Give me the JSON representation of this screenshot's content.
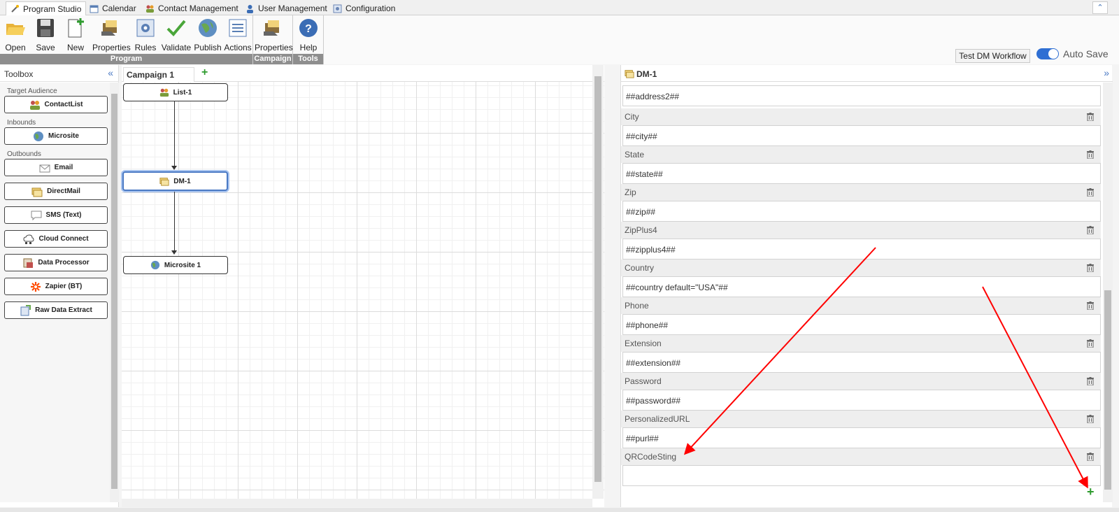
{
  "top_tabs": [
    "Program Studio",
    "Calendar",
    "Contact Management",
    "User Management",
    "Configuration"
  ],
  "ribbon": {
    "program_group": {
      "label": "Program",
      "buttons": [
        "Open",
        "Save",
        "New",
        "Properties",
        "Rules",
        "Validate",
        "Publish",
        "Actions"
      ]
    },
    "campaign_group": {
      "label": "Campaign",
      "buttons": [
        "Properties"
      ]
    },
    "tools_group": {
      "label": "Tools",
      "buttons": [
        "Help"
      ]
    },
    "test_button": "Test DM Workflow",
    "autosave_label": "Auto Save",
    "autosave_on": true
  },
  "toolbox": {
    "title": "Toolbox",
    "categories": [
      "Target Audience",
      "Inbounds",
      "Outbounds"
    ],
    "items": [
      "ContactList",
      "Microsite",
      "Email",
      "DirectMail",
      "SMS (Text)",
      "Cloud Connect",
      "Data Processor",
      "Zapier (BT)",
      "Raw Data Extract"
    ]
  },
  "canvas": {
    "tab": "Campaign 1",
    "add_tab": "+",
    "nodes": [
      "List-1",
      "DM-1",
      "Microsite 1"
    ],
    "selected": "DM-1"
  },
  "properties": {
    "title": "DM-1",
    "first_value": "##address2##",
    "fields": [
      {
        "label": "City",
        "value": "##city##"
      },
      {
        "label": "State",
        "value": "##state##"
      },
      {
        "label": "Zip",
        "value": "##zip##"
      },
      {
        "label": "ZipPlus4",
        "value": "##zipplus4##"
      },
      {
        "label": "Country",
        "value": "##country default=\"USA\"##"
      },
      {
        "label": "Phone",
        "value": "##phone##"
      },
      {
        "label": "Extension",
        "value": "##extension##"
      },
      {
        "label": "Password",
        "value": "##password##"
      },
      {
        "label": "PersonalizedURL",
        "value": "##purl##"
      },
      {
        "label": "QRCodeSting",
        "value": ""
      }
    ],
    "add_button": "+"
  },
  "colors": {
    "accent": "#4a79c4",
    "annotation": "#ff0000",
    "add_green": "#2e9b2e"
  }
}
